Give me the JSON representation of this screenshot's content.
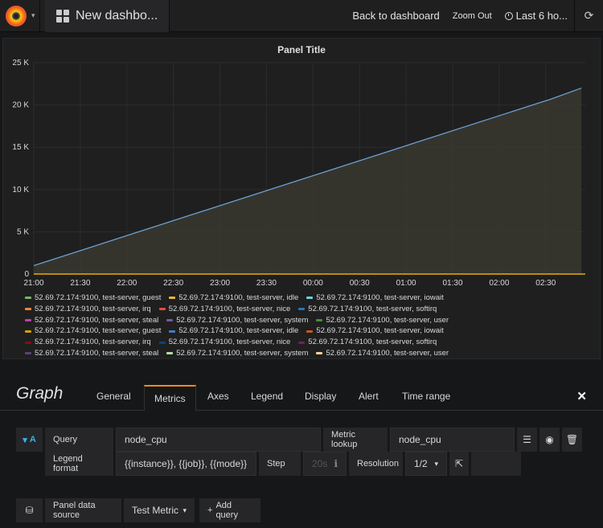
{
  "navbar": {
    "dashboard_title": "New dashbo...",
    "back_label": "Back to dashboard",
    "zoom_out_label": "Zoom Out",
    "time_range_label": "Last 6 ho..."
  },
  "panel": {
    "title": "Panel Title"
  },
  "chart_data": {
    "type": "area",
    "y_ticks": [
      "25 K",
      "20 K",
      "15 K",
      "10 K",
      "5 K",
      "0"
    ],
    "x_ticks": [
      "21:00",
      "21:30",
      "22:00",
      "22:30",
      "23:00",
      "23:30",
      "00:00",
      "00:30",
      "01:00",
      "01:30",
      "02:00",
      "02:30"
    ],
    "ylim": [
      0,
      25000
    ],
    "grid": true,
    "series": [
      {
        "name": "52.69.72.174:9100, test-server, idle",
        "x": [
          "21:00",
          "02:30",
          "02:32",
          "02:53"
        ],
        "values": [
          1000,
          20500,
          20600,
          22000
        ],
        "color": "#6d9fd1"
      }
    ]
  },
  "legend": {
    "rows": [
      [
        {
          "label": "52.69.72.174:9100, test-server, guest",
          "color": "#7eb26d"
        },
        {
          "label": "52.69.72.174:9100, test-server, idle",
          "color": "#eab839"
        },
        {
          "label": "52.69.72.174:9100, test-server, iowait",
          "color": "#6ed0e0"
        }
      ],
      [
        {
          "label": "52.69.72.174:9100, test-server, irq",
          "color": "#ef843c"
        },
        {
          "label": "52.69.72.174:9100, test-server, nice",
          "color": "#e24d42"
        },
        {
          "label": "52.69.72.174:9100, test-server, softirq",
          "color": "#1f78c1"
        }
      ],
      [
        {
          "label": "52.69.72.174:9100, test-server, steal",
          "color": "#ba43a9"
        },
        {
          "label": "52.69.72.174:9100, test-server, system",
          "color": "#705da0"
        },
        {
          "label": "52.69.72.174:9100, test-server, user",
          "color": "#508642"
        }
      ],
      [
        {
          "label": "52.69.72.174:9100, test-server, guest",
          "color": "#cca300"
        },
        {
          "label": "52.69.72.174:9100, test-server, idle",
          "color": "#447ebc"
        },
        {
          "label": "52.69.72.174:9100, test-server, iowait",
          "color": "#c15c17"
        }
      ],
      [
        {
          "label": "52.69.72.174:9100, test-server, irq",
          "color": "#890f02"
        },
        {
          "label": "52.69.72.174:9100, test-server, nice",
          "color": "#0a437c"
        },
        {
          "label": "52.69.72.174:9100, test-server, softirq",
          "color": "#6d1f62"
        }
      ],
      [
        {
          "label": "52.69.72.174:9100, test-server, steal",
          "color": "#584477"
        },
        {
          "label": "52.69.72.174:9100, test-server, system",
          "color": "#b7dbab"
        },
        {
          "label": "52.69.72.174:9100, test-server, user",
          "color": "#f4d598"
        }
      ]
    ]
  },
  "editor": {
    "title": "Graph",
    "tabs": [
      "General",
      "Metrics",
      "Axes",
      "Legend",
      "Display",
      "Alert",
      "Time range"
    ],
    "active_tab": "Metrics",
    "query": {
      "ref_id": "A",
      "query_label": "Query",
      "query_value": "node_cpu",
      "metric_lookup_label": "Metric lookup",
      "metric_lookup_value": "node_cpu",
      "legend_format_label": "Legend format",
      "legend_format_value": "{{instance}}, {{job}}, {{mode}}",
      "step_label": "Step",
      "step_placeholder": "20s",
      "resolution_label": "Resolution",
      "resolution_value": "1/2"
    },
    "datasource": {
      "label": "Panel data source",
      "value": "Test Metric",
      "add_query_label": "Add query"
    }
  },
  "colors": {
    "accent": "#f28c14",
    "link": "#33b5e5",
    "series_line": "#6d9fd1"
  }
}
